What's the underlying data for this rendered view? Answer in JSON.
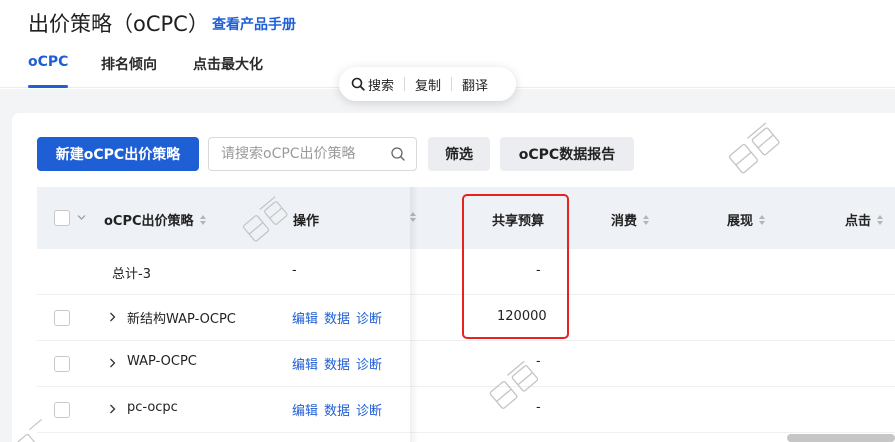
{
  "page": {
    "title": "出价策略（oCPC）",
    "manual_link": "查看产品手册"
  },
  "tabs": [
    {
      "label": "oCPC",
      "active": true
    },
    {
      "label": "排名倾向",
      "active": false
    },
    {
      "label": "点击最大化",
      "active": false
    }
  ],
  "float_toolbar": {
    "search": "搜索",
    "copy": "复制",
    "translate": "翻译"
  },
  "toolbar": {
    "new_button": "新建oCPC出价策略",
    "search_placeholder": "请搜索oCPC出价策略",
    "filter_button": "筛选",
    "report_button": "oCPC数据报告"
  },
  "table": {
    "headers": {
      "strategy": "oCPC出价策略",
      "actions": "操作",
      "shared_budget": "共享预算",
      "cost": "消费",
      "impressions": "展现",
      "clicks": "点击"
    },
    "summary": {
      "name": "总计-3",
      "actions": "-",
      "shared_budget": "-"
    },
    "rows": [
      {
        "name": "新结构WAP-OCPC",
        "edit": "编辑",
        "data": "数据",
        "diagnose": "诊断",
        "shared_budget": "120000"
      },
      {
        "name": "WAP-OCPC",
        "edit": "编辑",
        "data": "数据",
        "diagnose": "诊断",
        "shared_budget": "-"
      },
      {
        "name": "pc-ocpc",
        "edit": "编辑",
        "data": "数据",
        "diagnose": "诊断",
        "shared_budget": "-"
      }
    ]
  },
  "colors": {
    "accent": "#1f5fd6",
    "highlight": "#e8231f",
    "header_bg": "#eef1f6"
  }
}
